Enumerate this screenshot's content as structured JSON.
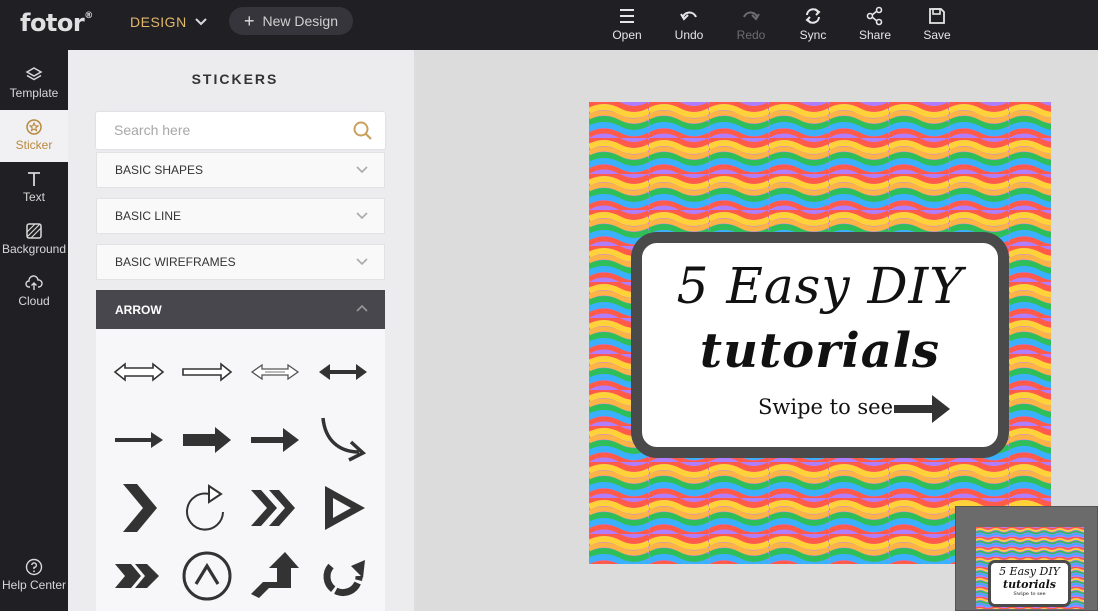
{
  "header": {
    "logo": "fotor",
    "logo_mark": "®",
    "design_menu": "DESIGN",
    "new_design": "New Design",
    "tools": [
      {
        "label": "Open",
        "icon": "menu-icon",
        "enabled": true
      },
      {
        "label": "Undo",
        "icon": "undo-icon",
        "enabled": true
      },
      {
        "label": "Redo",
        "icon": "redo-icon",
        "enabled": false
      },
      {
        "label": "Sync",
        "icon": "sync-icon",
        "enabled": true
      },
      {
        "label": "Share",
        "icon": "share-icon",
        "enabled": true
      },
      {
        "label": "Save",
        "icon": "save-icon",
        "enabled": true
      }
    ]
  },
  "leftnav": {
    "items": [
      {
        "label": "Template",
        "icon": "layers-icon"
      },
      {
        "label": "Sticker",
        "icon": "sticker-icon",
        "active": true
      },
      {
        "label": "Text",
        "icon": "text-icon"
      },
      {
        "label": "Background",
        "icon": "background-icon"
      },
      {
        "label": "Cloud",
        "icon": "cloud-upload-icon"
      }
    ],
    "help": {
      "label": "Help Center",
      "icon": "help-icon"
    }
  },
  "panel": {
    "title": "STICKERS",
    "search_placeholder": "Search here",
    "sections": [
      {
        "label": "BASIC SHAPES",
        "open": false
      },
      {
        "label": "BASIC LINE",
        "open": false
      },
      {
        "label": "BASIC WIREFRAMES",
        "open": false
      },
      {
        "label": "ARROW",
        "open": true
      }
    ],
    "arrow_stickers": [
      "double-outline-arrow-icon",
      "outline-right-arrow-icon",
      "thin-double-outline-arrow-icon",
      "solid-double-arrow-icon",
      "thin-right-arrow-icon",
      "thick-right-arrow-icon",
      "bold-right-arrow-icon",
      "curved-down-arrow-icon",
      "chevron-right-icon",
      "circular-arrow-icon",
      "double-chevron-icon",
      "play-arrow-icon",
      "double-chevron-filled-icon",
      "circle-up-chevron-icon",
      "up-turn-arrow-icon",
      "refresh-arrow-icon"
    ]
  },
  "canvas": {
    "line1": "5 Easy DIY",
    "line2": "tutorials",
    "line3": "Swipe to see",
    "mini_line3": "Swipe to see",
    "stripe_colors": [
      "#ff5a4a",
      "#ffd23a",
      "#2fbf5a",
      "#3ab0ff",
      "#b07dff",
      "#ffb347"
    ],
    "card_border_color": "#4a4a4a"
  }
}
